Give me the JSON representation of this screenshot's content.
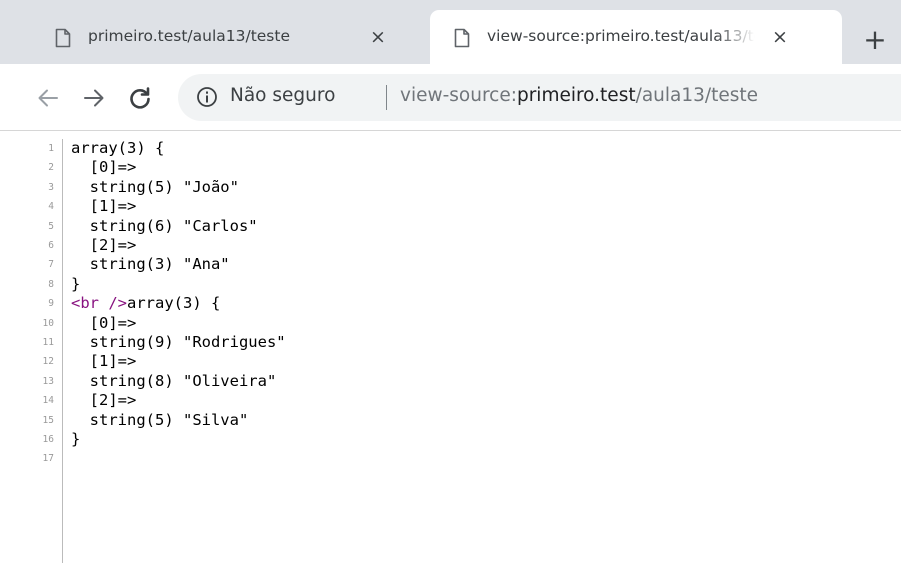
{
  "tabs": [
    {
      "title": "primeiro.test/aula13/teste",
      "icon": "page-icon",
      "close": "×"
    },
    {
      "title": "view-source:primeiro.test/aula13/teste",
      "icon": "page-icon",
      "close": "×"
    }
  ],
  "new_tab_label": "+",
  "toolbar": {
    "security_label": "Não seguro",
    "url_prefix": "view-source:",
    "url_host": "primeiro.test",
    "url_path": "/aula13/teste"
  },
  "source": {
    "lines": [
      {
        "n": "1",
        "pre": "",
        "tag": "",
        "text": "array(3) {"
      },
      {
        "n": "2",
        "pre": "",
        "tag": "",
        "text": "  [0]=>"
      },
      {
        "n": "3",
        "pre": "",
        "tag": "",
        "text": "  string(5) \"João\""
      },
      {
        "n": "4",
        "pre": "",
        "tag": "",
        "text": "  [1]=>"
      },
      {
        "n": "5",
        "pre": "",
        "tag": "",
        "text": "  string(6) \"Carlos\""
      },
      {
        "n": "6",
        "pre": "",
        "tag": "",
        "text": "  [2]=>"
      },
      {
        "n": "7",
        "pre": "",
        "tag": "",
        "text": "  string(3) \"Ana\""
      },
      {
        "n": "8",
        "pre": "",
        "tag": "",
        "text": "}"
      },
      {
        "n": "9",
        "pre": "",
        "tag": "<br />",
        "text": "array(3) {"
      },
      {
        "n": "10",
        "pre": "",
        "tag": "",
        "text": "  [0]=>"
      },
      {
        "n": "11",
        "pre": "",
        "tag": "",
        "text": "  string(9) \"Rodrigues\""
      },
      {
        "n": "12",
        "pre": "",
        "tag": "",
        "text": "  [1]=>"
      },
      {
        "n": "13",
        "pre": "",
        "tag": "",
        "text": "  string(8) \"Oliveira\""
      },
      {
        "n": "14",
        "pre": "",
        "tag": "",
        "text": "  [2]=>"
      },
      {
        "n": "15",
        "pre": "",
        "tag": "",
        "text": "  string(5) \"Silva\""
      },
      {
        "n": "16",
        "pre": "",
        "tag": "",
        "text": "}"
      },
      {
        "n": "17",
        "pre": "",
        "tag": "",
        "text": ""
      }
    ]
  },
  "colors": {
    "tabstrip_bg": "#dee1e6",
    "omnibox_bg": "#f1f3f4",
    "tag": "#881280",
    "line_number": "#999999"
  }
}
